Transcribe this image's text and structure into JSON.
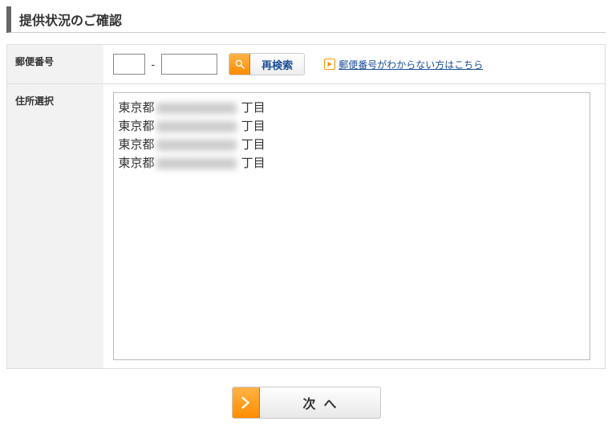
{
  "title": "提供状況のご確認",
  "form": {
    "postal_label": "郵便番号",
    "address_label": "住所選択",
    "zip_separator": "-",
    "zip1_value": "",
    "zip2_value": "",
    "search_button": "再検索",
    "help_link": "郵便番号がわからない方はこちら"
  },
  "addresses": [
    {
      "prefix": "東京都",
      "masked": "■■■■■■",
      "suffix": "丁目"
    },
    {
      "prefix": "東京都",
      "masked": "■■■■■■",
      "suffix": "丁目"
    },
    {
      "prefix": "東京都",
      "masked": "■■■■■■",
      "suffix": "丁目"
    },
    {
      "prefix": "東京都",
      "masked": "■■■■■■",
      "suffix": "丁目"
    }
  ],
  "next_button": "次へ"
}
